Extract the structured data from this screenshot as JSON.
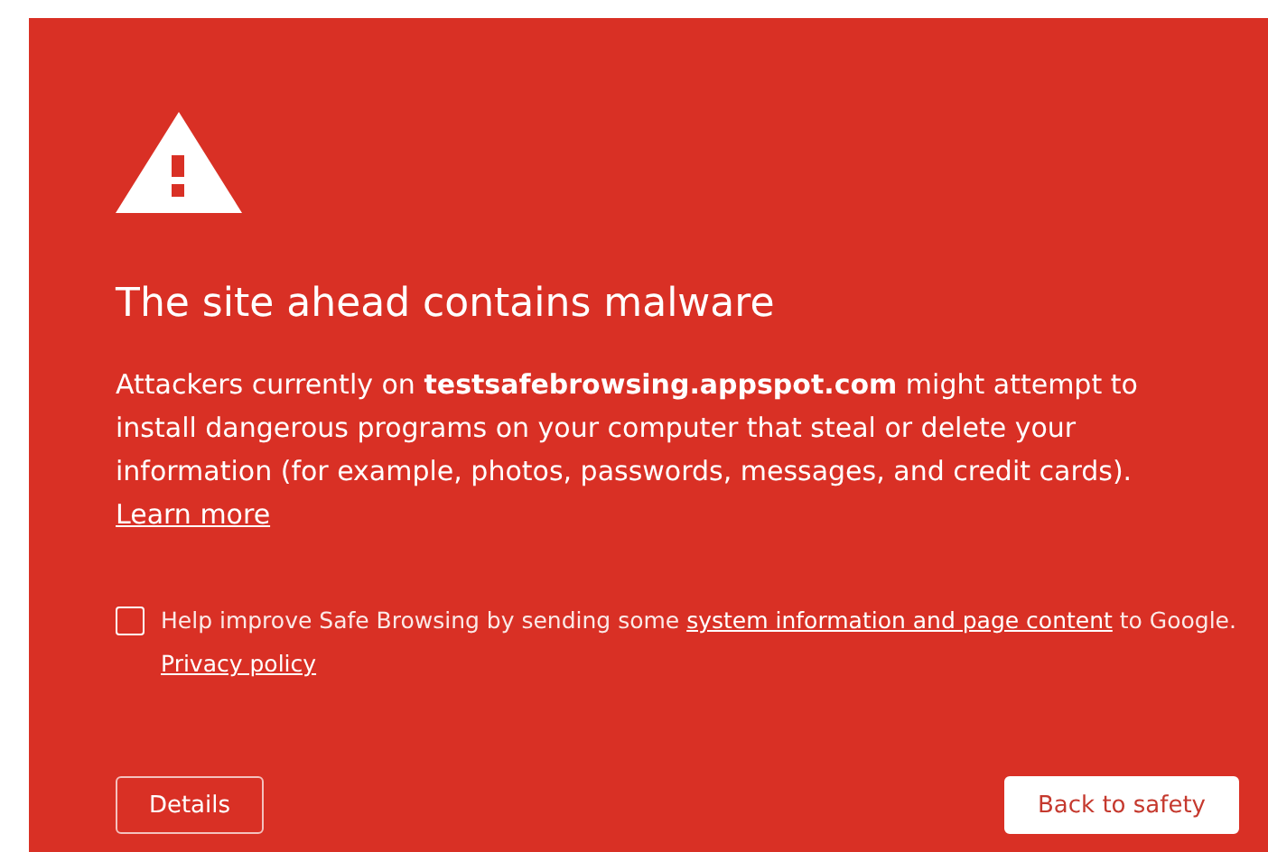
{
  "heading": "The site ahead contains malware",
  "message": "Attackers currently on **testsafebrowsing.appspot.com** might attempt to install dangerous programs on your computer that steal or delete your information (for example, photos, passwords, messages, and credit cards).",
  "learn_more": "Learn more",
  "report_option": {
    "checked": false,
    "parts": [
      {
        "kind": "text",
        "text": "Help improve Safe Browsing by sending some "
      },
      {
        "kind": "link",
        "text": "system information and page content"
      },
      {
        "kind": "text",
        "text": " to Google. "
      },
      {
        "kind": "link",
        "text": "Privacy policy"
      }
    ]
  },
  "buttons": [
    {
      "label": "Details",
      "kind": "secondary"
    },
    {
      "label": "Back to safety",
      "kind": "primary"
    }
  ]
}
